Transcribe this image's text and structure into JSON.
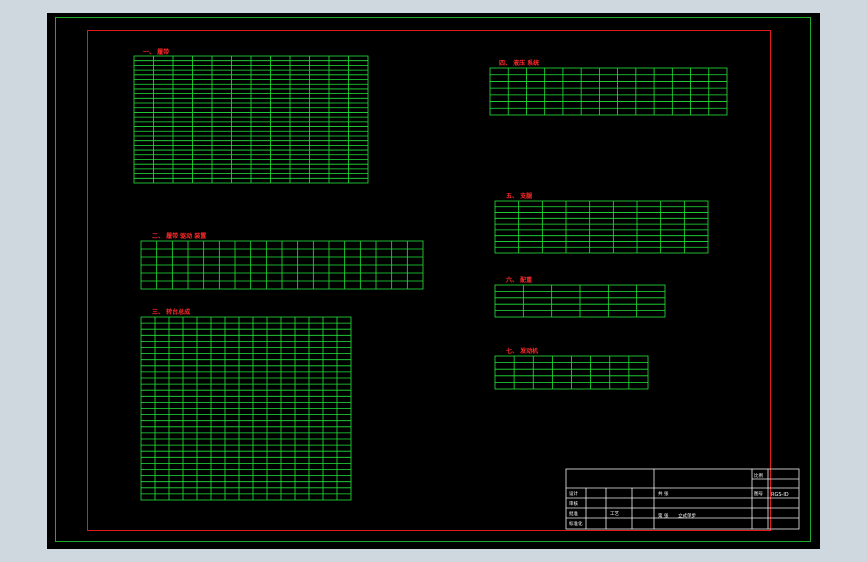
{
  "tables": [
    {
      "id": "t1",
      "title": "一、 履带",
      "rows": 27,
      "cols": 12
    },
    {
      "id": "t2",
      "title": "二、 履带 驱动 装置",
      "rows": 6,
      "cols": 18
    },
    {
      "id": "t3",
      "title": "三、 转台总成",
      "rows": 30,
      "cols": 15
    },
    {
      "id": "t4",
      "title": "四、 液压 系统",
      "rows": 7,
      "cols": 13
    },
    {
      "id": "t5",
      "title": "五、 支腿",
      "rows": 9,
      "cols": 9
    },
    {
      "id": "t6",
      "title": "六、 配重",
      "rows": 5,
      "cols": 6
    },
    {
      "id": "t7",
      "title": "七、 发动机",
      "rows": 5,
      "cols": 8
    }
  ],
  "title_block": {
    "doc_code": "RGS-ID",
    "drawing_title": "立式单步",
    "labels": [
      "设计",
      "审核",
      "批准",
      "标准化",
      "工艺",
      "共 张",
      "第 张",
      "比例",
      "图号",
      "设计图名"
    ]
  }
}
